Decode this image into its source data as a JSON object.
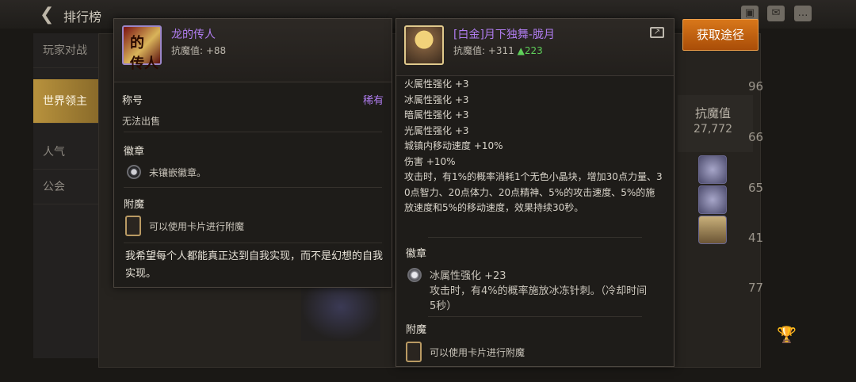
{
  "top": {
    "title": "排行榜",
    "icons": [
      "bag-icon",
      "mail-icon",
      "chat-icon"
    ]
  },
  "sidebar": {
    "items": [
      {
        "label": "玩家对战"
      },
      {
        "label": "世界领主",
        "active": true
      },
      {
        "label": "人气"
      },
      {
        "label": "公会"
      }
    ]
  },
  "background": {
    "col_label": "抗魔值",
    "col_value": "27,772",
    "ranks": [
      "96",
      "66",
      "65",
      "41",
      "77"
    ]
  },
  "left_card": {
    "name": "龙的传人",
    "stat_label": "抗魔值: +88",
    "category": "称号",
    "rarity": "稀有",
    "trade": "无法出售",
    "emblem_title": "徽章",
    "emblem_text": "未镶嵌徽章。",
    "enchant_title": "附魔",
    "enchant_text": "可以使用卡片进行附魔",
    "quote": "我希望每个人都能真正达到自我实现，而不是幻想的自我实现。",
    "icon_text": "的\n传人"
  },
  "right_card": {
    "name": "[白金]月下独舞-胧月",
    "stat_label": "抗魔值: +311",
    "stat_up": "▲223",
    "attributes": [
      "火属性强化 +3",
      "冰属性强化 +3",
      "暗属性强化 +3",
      "光属性强化 +3",
      "城镇内移动速度 +10%",
      "伤害 +10%",
      "攻击时，有1%的概率消耗1个无色小晶块，增加30点力量、3",
      "0点智力、20点体力、20点精神、5%的攻击速度、5%的施",
      "放速度和5%的移动速度，效果持续30秒。"
    ],
    "emblem_title": "徽章",
    "emblem_name": "冰属性强化 +23",
    "emblem_desc_1": "攻击时，有4%的概率施放冰冻针刺。（冷却时间",
    "emblem_desc_2": "5秒）",
    "enchant_title": "附魔",
    "enchant_text": "可以使用卡片进行附魔"
  },
  "get_source_button": "获取途径"
}
